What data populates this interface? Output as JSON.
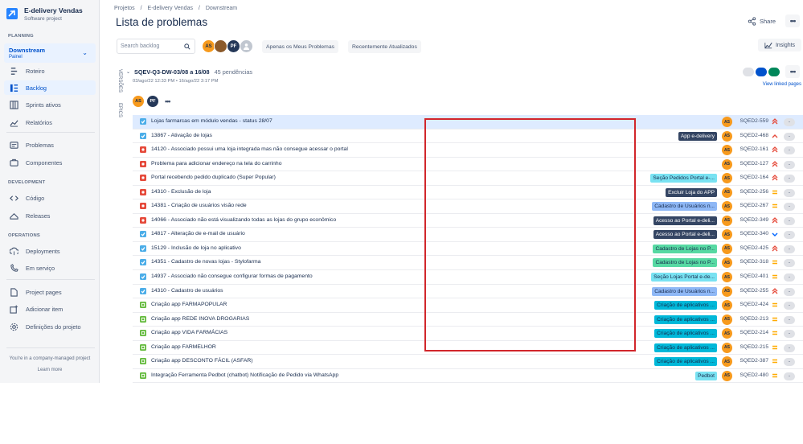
{
  "project": {
    "name": "E-delivery Vendas",
    "type": "Software project"
  },
  "sidebar": {
    "planning_label": "PLANNING",
    "board": {
      "name": "Downstream",
      "sub": "Painel"
    },
    "planning_items": [
      {
        "label": "Roteiro",
        "icon": "roadmap-icon"
      },
      {
        "label": "Backlog",
        "icon": "backlog-icon",
        "selected": true
      },
      {
        "label": "Sprints ativos",
        "icon": "board-icon"
      },
      {
        "label": "Relatórios",
        "icon": "reports-icon"
      }
    ],
    "other_items": [
      {
        "label": "Problemas",
        "icon": "issues-icon"
      },
      {
        "label": "Componentes",
        "icon": "components-icon"
      }
    ],
    "development_label": "DEVELOPMENT",
    "development_items": [
      {
        "label": "Código",
        "icon": "code-icon"
      },
      {
        "label": "Releases",
        "icon": "releases-icon"
      }
    ],
    "operations_label": "OPERATIONS",
    "operations_items": [
      {
        "label": "Deployments",
        "icon": "deployments-icon"
      },
      {
        "label": "Em serviço",
        "icon": "on-call-icon"
      }
    ],
    "footer_items": [
      {
        "label": "Project pages",
        "icon": "pages-icon"
      },
      {
        "label": "Adicionar item",
        "icon": "add-item-icon"
      },
      {
        "label": "Definições do projeto",
        "icon": "settings-icon"
      }
    ],
    "company_managed": "You're in a company-managed project",
    "learn_more": "Learn more"
  },
  "breadcrumb": {
    "a": "Projetos",
    "b": "E-delivery Vendas",
    "c": "Downstream",
    "sep": "/"
  },
  "page_title": "Lista de problemas",
  "share_label": "Share",
  "search_placeholder": "Search backlog",
  "avatars": [
    "AS",
    "PF"
  ],
  "filters": {
    "mine": "Apenas os Meus Problemas",
    "recent": "Recentemente Atualizados"
  },
  "insights_label": "Insights",
  "vtabs": {
    "versions": "VERSÕES",
    "epics": "EPICS"
  },
  "sprint": {
    "name": "SQEV-Q3-DW-03/08 a 16/08",
    "count": "45 pendências",
    "dates": "03/ago/22 12:33 PM • 16/ago/22 3:17 PM",
    "linked": "View linked pages",
    "avatars": [
      "AS",
      "PF"
    ],
    "pills": [
      "#dfe1e6",
      "#0052cc",
      "#00875a"
    ]
  },
  "colors": {
    "story": "#4bade8",
    "bug": "#e5493a",
    "task_green": "#63ba3c",
    "highlight_box": "#d1262b"
  },
  "issues": [
    {
      "type": "story",
      "title": "Lojas farmarcas em módulo vendas - status 28/07",
      "epic": "",
      "epic_style": "",
      "key": "SQED2-559",
      "priority": "highest",
      "est": "-"
    },
    {
      "type": "story",
      "title": "13867 - Ativação de lojas",
      "epic": "App e-delivery",
      "epic_style": "dark",
      "key": "SQED2-468",
      "priority": "high",
      "est": "-"
    },
    {
      "type": "bug",
      "title": "14120 - Associado possui uma loja integrada mas não consegue acessar o portal",
      "epic": "",
      "epic_style": "",
      "key": "SQED2-161",
      "priority": "highest",
      "est": "-"
    },
    {
      "type": "bug",
      "title": "Problema para adicionar endereço na tela do carrinho",
      "epic": "",
      "epic_style": "",
      "key": "SQED2-127",
      "priority": "highest",
      "est": "-"
    },
    {
      "type": "bug",
      "title": "Portal recebendo pedido duplicado (Super Popular)",
      "epic": "Seção Pedidos Portal e-...",
      "epic_style": "cyan",
      "key": "SQED2-164",
      "priority": "highest",
      "est": "-"
    },
    {
      "type": "bug",
      "title": "14310 - Exclusão de loja",
      "epic": "Excluir Loja do APP",
      "epic_style": "dark",
      "key": "SQED2-256",
      "priority": "medium",
      "est": "-"
    },
    {
      "type": "bug",
      "title": "14381 - Criação de usuários visão rede",
      "epic": "Cadastro de Usuários n...",
      "epic_style": "blue",
      "key": "SQED2-267",
      "priority": "medium",
      "est": "-"
    },
    {
      "type": "bug",
      "title": "14066 - Associado não está visualizando todas as lojas do grupo econômico",
      "epic": "Acesso ao Portal e-deli...",
      "epic_style": "dark",
      "key": "SQED2-349",
      "priority": "highest",
      "est": "-"
    },
    {
      "type": "story",
      "title": "14817 - Alteração de e-mail de usuário",
      "epic": "Acesso ao Portal e-deli...",
      "epic_style": "dark",
      "key": "SQED2-340",
      "priority": "low",
      "est": "-"
    },
    {
      "type": "story",
      "title": "15129 - Inclusão de loja no aplicativo",
      "epic": "Cadastro de Lojas no P...",
      "epic_style": "green",
      "key": "SQED2-425",
      "priority": "highest",
      "est": "-"
    },
    {
      "type": "story",
      "title": "14351 - Cadastro de novas lojas - Stylofarma",
      "epic": "Cadastro de Lojas no P...",
      "epic_style": "green",
      "key": "SQED2-318",
      "priority": "medium",
      "est": "-"
    },
    {
      "type": "story",
      "title": "14937 - Associado não consegue configurar formas de pagamento",
      "epic": "Seção Lojas Portal e-de...",
      "epic_style": "cyan",
      "key": "SQED2-401",
      "priority": "medium",
      "est": "-"
    },
    {
      "type": "story",
      "title": "14310 - Cadastro de usuários",
      "epic": "Cadastro de Usuários n...",
      "epic_style": "blue",
      "key": "SQED2-255",
      "priority": "highest",
      "est": "-"
    },
    {
      "type": "task",
      "title": "Criação app FARMAPOPULAR",
      "epic": "Criação de aplicativos ...",
      "epic_style": "teal",
      "key": "SQED2-424",
      "priority": "medium",
      "est": "-"
    },
    {
      "type": "task",
      "title": "Criação app REDE INOVA DROGARIAS",
      "epic": "Criação de aplicativos ...",
      "epic_style": "teal",
      "key": "SQED2-213",
      "priority": "medium",
      "est": "-"
    },
    {
      "type": "task",
      "title": "Criação app VIDA FARMÁCIAS",
      "epic": "Criação de aplicativos ...",
      "epic_style": "teal",
      "key": "SQED2-214",
      "priority": "medium",
      "est": "-"
    },
    {
      "type": "task",
      "title": "Criação app FARMELHOR",
      "epic": "Criação de aplicativos ...",
      "epic_style": "teal",
      "key": "SQED2-215",
      "priority": "medium",
      "est": "-"
    },
    {
      "type": "task",
      "title": "Criação app DESCONTO FÁCIL (ASFAR)",
      "epic": "Criação de aplicativos ...",
      "epic_style": "teal",
      "key": "SQED2-387",
      "priority": "medium",
      "est": "-"
    },
    {
      "type": "task",
      "title": "Integração Ferramenta Pedbot (chatbot) Notificação de Pedido via WhatsApp",
      "epic": "Pedbot",
      "epic_style": "cyan",
      "key": "SQED2-480",
      "priority": "medium",
      "est": "-"
    }
  ]
}
